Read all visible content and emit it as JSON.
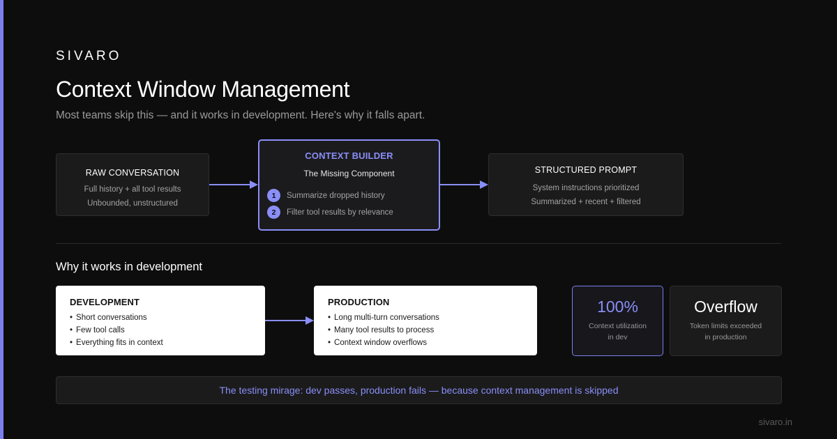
{
  "brand": "SIVARO",
  "title": "Context Window Management",
  "subtitle": "Most teams skip this — and it works in development. Here's why it falls apart.",
  "colors": {
    "accent": "#8a8ef7",
    "background": "#0d0d0d",
    "card": "#1b1b1c"
  },
  "flow": {
    "raw": {
      "title": "RAW CONVERSATION",
      "lines": [
        "Full history + all tool results",
        "Unbounded, unstructured"
      ]
    },
    "builder": {
      "title": "CONTEXT BUILDER",
      "subtitle": "The Missing Component",
      "steps": [
        {
          "num": "1",
          "text": "Summarize dropped history"
        },
        {
          "num": "2",
          "text": "Filter tool results by relevance"
        }
      ]
    },
    "structured": {
      "title": "STRUCTURED PROMPT",
      "lines": [
        "System instructions prioritized",
        "Summarized + recent + filtered"
      ]
    }
  },
  "section_title": "Why it works in development",
  "development": {
    "title": "DEVELOPMENT",
    "items": [
      "Short conversations",
      "Few tool calls",
      "Everything fits in context"
    ]
  },
  "production": {
    "title": "PRODUCTION",
    "items": [
      "Long multi-turn conversations",
      "Many tool results to process",
      "Context window overflows"
    ]
  },
  "stats": [
    {
      "value": "100%",
      "lines": [
        "Context utilization",
        "in dev"
      ]
    },
    {
      "value": "Overflow",
      "lines": [
        "Token limits exceeded",
        "in production"
      ]
    }
  ],
  "mirage": "The testing mirage: dev passes, production fails — because context management is skipped",
  "footer": "sivaro.in"
}
